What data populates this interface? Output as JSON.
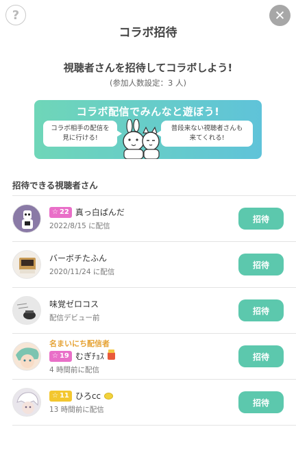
{
  "header": {
    "help_icon": "question-icon",
    "help_glyph": "?",
    "close_icon": "close-icon",
    "close_glyph": "✕",
    "title": "コラボ招待"
  },
  "intro": {
    "headline": "視聴者さんを招待してコラボしよう!",
    "participants": "(参加人数設定：3 人)"
  },
  "banner": {
    "title": "コラボ配信でみんなと遊ぼう!",
    "left_line1": "コラボ相手の配信を",
    "left_line2": "見に行ける!",
    "right_line1": "普段来ない視聴者さんも",
    "right_line2": "来てくれる!",
    "colors": {
      "start": "#6fd6b8",
      "end": "#5fc3d9"
    }
  },
  "section_label": "招待できる視聴者さん",
  "colors": {
    "invite_button": "#5cc8ad",
    "badge_pink": "#e96fc8",
    "badge_yellow": "#f3c72f",
    "special_label": "#e5a233"
  },
  "viewers": [
    {
      "badge_level": "22",
      "name": "真っ白ぱんだ",
      "sub": "2022/8/15 に配信",
      "special": "",
      "invite_label": "招待"
    },
    {
      "badge_level": "",
      "name": "バーボチたふん",
      "sub": "2020/11/24 に配信",
      "special": "",
      "invite_label": "招待"
    },
    {
      "badge_level": "",
      "name": "味覚ゼロコス",
      "sub": "配信デビュー前",
      "special": "",
      "invite_label": "招待"
    },
    {
      "badge_level": "19",
      "name": "むぎﾁｮｽ",
      "sub": "4 時間前に配信",
      "special": "名まいにち配信者",
      "invite_label": "招待"
    },
    {
      "badge_level": "11",
      "name": "ひろcc",
      "sub": "13 時間前に配信",
      "special": "",
      "invite_label": "招待"
    }
  ]
}
